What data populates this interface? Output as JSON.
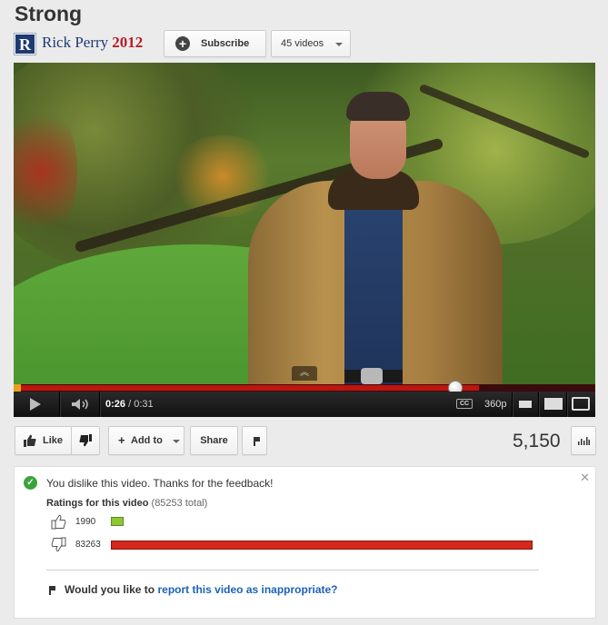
{
  "video": {
    "title": "Strong",
    "current_time": "0:26",
    "duration": "/ 0:31",
    "progress_fraction": 0.8,
    "quality": "360p",
    "cc_label": "CC",
    "views": "5,150"
  },
  "channel": {
    "logo_letter": "R",
    "name": "Rick Perry",
    "year": "2012",
    "subscribe_label": "Subscribe",
    "videos_label": "45 videos"
  },
  "actions": {
    "like_label": "Like",
    "addto_label": "Add to",
    "share_label": "Share"
  },
  "ratings_panel": {
    "message": "You dislike this video. Thanks for the feedback!",
    "title": "Ratings for this video",
    "total": "(85253 total)",
    "likes": "1990",
    "dislikes": "83263",
    "likes_value": 1990,
    "dislikes_value": 83263,
    "report_prefix": "Would you like to",
    "report_link": "report this video as inappropriate?"
  },
  "colors": {
    "progress": "#c0140f",
    "like_bar": "#8fc735",
    "dislike_bar": "#d3281a",
    "link": "#1c62b9",
    "channel_name": "#1d3a72",
    "channel_year": "#b51d2a"
  },
  "icons": [
    "plus-icon",
    "caret-down-icon",
    "play-icon",
    "volume-icon",
    "cc-icon",
    "fullscreen-icon",
    "thumbs-up-icon",
    "thumbs-down-icon",
    "flag-icon",
    "stats-icon",
    "check-icon",
    "close-icon"
  ]
}
